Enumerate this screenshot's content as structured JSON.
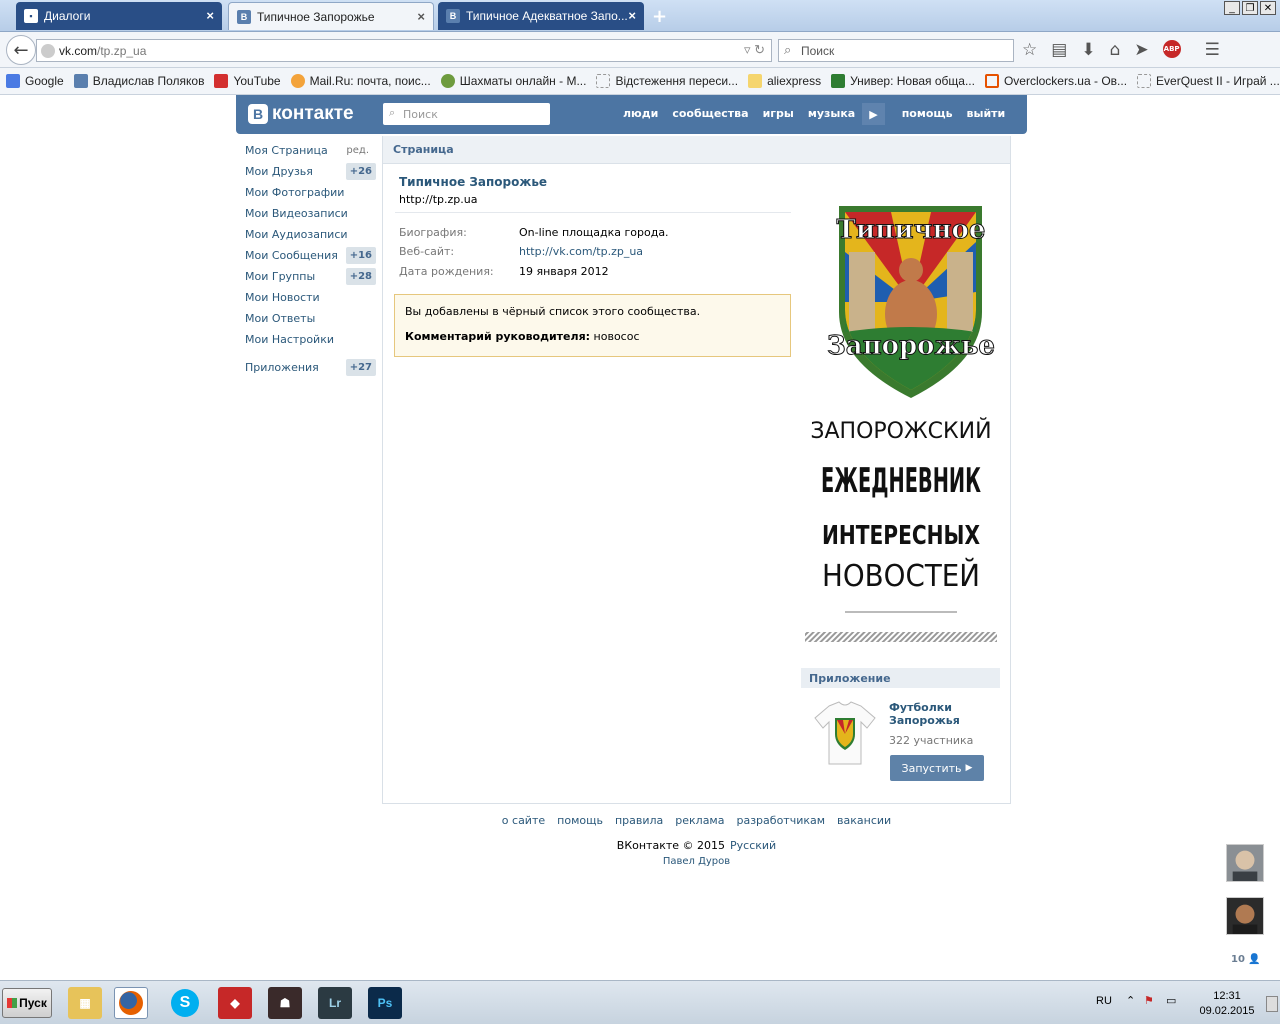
{
  "browser": {
    "tabs": [
      {
        "label": "Диалоги"
      },
      {
        "label": "Типичное Запорожье"
      },
      {
        "label": "Типичное Адекватное Запо..."
      }
    ],
    "url_host": "vk.com",
    "url_path": "/tp.zp_ua",
    "search_placeholder": "Поиск",
    "bookmarks": [
      {
        "label": "Google"
      },
      {
        "label": "Владислав Поляков"
      },
      {
        "label": "YouTube"
      },
      {
        "label": "Mail.Ru: почта, поис..."
      },
      {
        "label": "Шахматы онлайн - М..."
      },
      {
        "label": "Відстеження переси..."
      },
      {
        "label": "aliexpress"
      },
      {
        "label": "Универ: Новая обща..."
      },
      {
        "label": "Overclockers.ua - Ов..."
      },
      {
        "label": "EverQuest II - Играй ..."
      }
    ]
  },
  "vk": {
    "logo": "контакте",
    "search_placeholder": "Поиск",
    "nav": [
      "люди",
      "сообщества",
      "игры",
      "музыка",
      "помощь",
      "выйти"
    ]
  },
  "menu": {
    "edit": "ред.",
    "items": [
      {
        "label": "Моя Страница",
        "count": ""
      },
      {
        "label": "Мои Друзья",
        "count": "+26"
      },
      {
        "label": "Мои Фотографии",
        "count": ""
      },
      {
        "label": "Мои Видеозаписи",
        "count": ""
      },
      {
        "label": "Мои Аудиозаписи",
        "count": ""
      },
      {
        "label": "Мои Сообщения",
        "count": "+16"
      },
      {
        "label": "Мои Группы",
        "count": "+28"
      },
      {
        "label": "Мои Новости",
        "count": ""
      },
      {
        "label": "Мои Ответы",
        "count": ""
      },
      {
        "label": "Мои Настройки",
        "count": ""
      }
    ],
    "apps": {
      "label": "Приложения",
      "count": "+27"
    }
  },
  "page": {
    "breadcrumb": "Страница",
    "name": "Типичное Запорожье",
    "status": "http://tp.zp.ua",
    "info": [
      {
        "key": "Биография:",
        "value": "On-line площадка города."
      },
      {
        "key": "Веб-сайт:",
        "value": "http://vk.com/tp.zp_ua"
      },
      {
        "key": "Дата рождения:",
        "value": "19 января 2012"
      }
    ],
    "notice_text": "Вы добавлены в чёрный список этого сообщества.",
    "notice_comment_label": "Комментарий руководителя:",
    "notice_comment": "новосос",
    "logo_text": {
      "shield_top": "Типичное",
      "shield_bottom": "Запорожье",
      "line1": "ЗАПОРОЖСКИЙ",
      "line2": "ЕЖЕДНЕВНИК",
      "line3": "ИНТЕРЕСНЫХ",
      "line4": "НОВОСТЕЙ"
    }
  },
  "app": {
    "section_title": "Приложение",
    "name": "Футболки Запорожья",
    "members": "322 участника",
    "button": "Запустить"
  },
  "footer": {
    "links": [
      "о сайте",
      "помощь",
      "правила",
      "реклама",
      "разработчикам",
      "вакансии"
    ],
    "copyright": "ВКонтакте © 2015",
    "language": "Русский",
    "author": "Павел Дуров"
  },
  "friends_online_count": "10",
  "taskbar": {
    "start": "Пуск",
    "lang": "RU",
    "time": "12:31",
    "date": "09.02.2015",
    "apps": [
      "explorer",
      "firefox",
      "skype",
      "app-red",
      "game",
      "Lr",
      "Ps"
    ]
  }
}
